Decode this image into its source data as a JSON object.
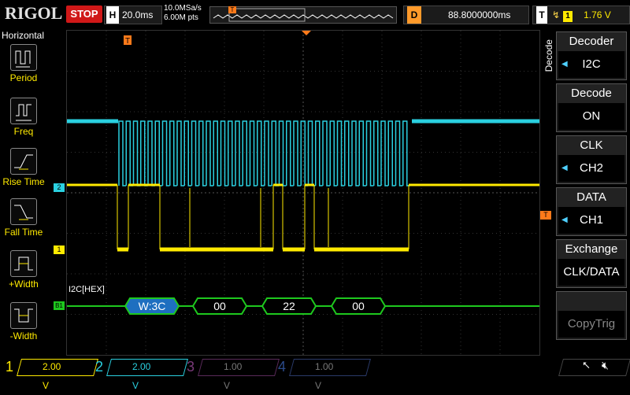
{
  "topbar": {
    "brand": "RIGOL",
    "run_state": "STOP",
    "timebase_label": "H",
    "timebase_value": "20.0ms",
    "sample_rate": "10.0MSa/s",
    "memory_depth": "6.00M pts",
    "trigger_marker": "T",
    "delay_label": "D",
    "delay_value": "88.8000000ms",
    "trigger_label": "T",
    "trigger_icon": "rising-edge-icon",
    "trigger_channel": "1",
    "trigger_level": "1.76 V"
  },
  "left_panel": {
    "title": "Horizontal",
    "items": [
      {
        "label": "Period",
        "icon": "period-icon"
      },
      {
        "label": "Freq",
        "icon": "freq-icon"
      },
      {
        "label": "Rise Time",
        "icon": "rise-time-icon"
      },
      {
        "label": "Fall Time",
        "icon": "fall-time-icon"
      },
      {
        "label": "+Width",
        "icon": "pos-width-icon"
      },
      {
        "label": "-Width",
        "icon": "neg-width-icon"
      }
    ]
  },
  "screen": {
    "ch2_marker": "2",
    "ch1_marker": "1",
    "bus_marker": "B1",
    "trigger_level_marker": "T",
    "trigger_pos_marker": "T",
    "bus_label": "I2C[HEX]",
    "packets": [
      "W:3C",
      "00",
      "22",
      "00"
    ]
  },
  "right_panel": {
    "side_label": "Decode",
    "buttons": [
      {
        "head": "Decoder",
        "value": "I2C"
      },
      {
        "head": "Decode",
        "value": "ON"
      },
      {
        "head": "CLK",
        "value": "CH2"
      },
      {
        "head": "DATA",
        "value": "CH1"
      },
      {
        "head": "Exchange",
        "value": "CLK/DATA"
      },
      {
        "head": "",
        "value": "CopyTrig"
      }
    ]
  },
  "bottombar": {
    "channels": [
      {
        "num": "1",
        "scale": "2.00 V",
        "color": "#ffea00"
      },
      {
        "num": "2",
        "scale": "2.00 V",
        "color": "#2ad0e0"
      },
      {
        "num": "3",
        "scale": "1.00 V",
        "color": "#c040c0"
      },
      {
        "num": "4",
        "scale": "1.00 V",
        "color": "#2060e0"
      }
    ]
  },
  "colors": {
    "ch1": "#ffea00",
    "ch2": "#2ad0e0",
    "bus": "#1ec81e",
    "stop": "#d01818",
    "orange": "#ff7a1a"
  }
}
